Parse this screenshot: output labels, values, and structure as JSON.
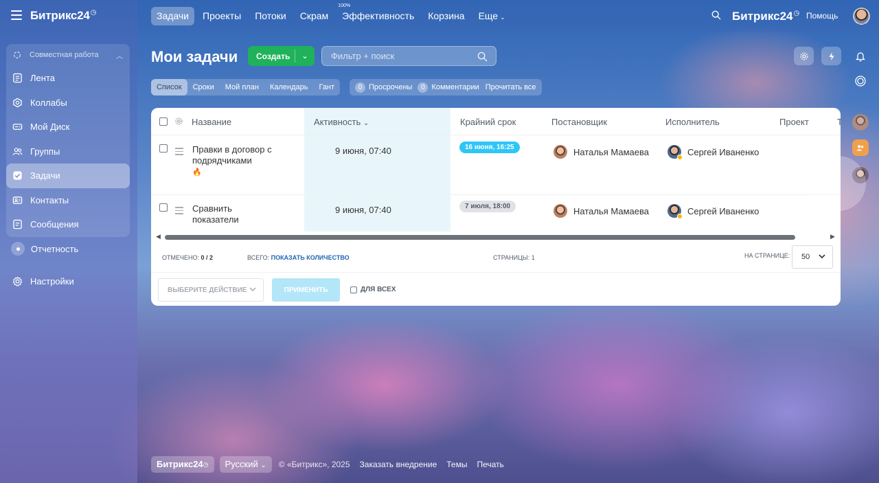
{
  "header": {
    "logo": "Битрикс24",
    "logo_mark": "◷",
    "nav": [
      {
        "label": "Задачи",
        "active": true
      },
      {
        "label": "Проекты"
      },
      {
        "label": "Потоки"
      },
      {
        "label": "Скрам"
      },
      {
        "label": "Эффективность",
        "sup": "100%"
      },
      {
        "label": "Корзина"
      },
      {
        "label": "Еще",
        "chevron": "⌄"
      }
    ],
    "brand_right": "Битрикс24",
    "help": "Помощь"
  },
  "sidebar": {
    "group_title": "Совместная работа",
    "items": [
      {
        "label": "Лента",
        "icon": "feed-icon"
      },
      {
        "label": "Коллабы",
        "icon": "collab-icon"
      },
      {
        "label": "Мой Диск",
        "icon": "disk-icon"
      },
      {
        "label": "Группы",
        "icon": "groups-icon"
      },
      {
        "label": "Задачи",
        "icon": "tasks-icon",
        "active": true
      },
      {
        "label": "Контакты",
        "icon": "contacts-icon"
      },
      {
        "label": "Сообщения",
        "icon": "messages-icon"
      }
    ],
    "reports": "Отчетность",
    "settings": "Настройки"
  },
  "page": {
    "title": "Мои задачи",
    "create": "Создать",
    "filter_placeholder": "Фильтр + поиск"
  },
  "views": {
    "tabs": [
      "Список",
      "Сроки",
      "Мой план",
      "Календарь",
      "Гант"
    ],
    "overdue_count": "0",
    "overdue_label": "Просрочены",
    "comments_count": "0",
    "comments_label": "Комментарии",
    "read_all": "Прочитать все"
  },
  "grid": {
    "columns": {
      "name": "Название",
      "activity": "Активность",
      "deadline": "Крайний срок",
      "creator": "Постановщик",
      "responsible": "Исполнитель",
      "project": "Проект",
      "cut": "Т"
    },
    "rows": [
      {
        "name": "Правки в договор с подрядчиками",
        "activity": "9 июня, 07:40",
        "deadline": "16 июня, 16:25",
        "creator": "Наталья Мамаева",
        "responsible": "Сергей Иваненко",
        "hot": "🔥"
      },
      {
        "name": "Сравнить показатели",
        "activity": "9 июня, 07:40",
        "deadline": "7 июля, 18:00",
        "creator": "Наталья Мамаева",
        "responsible": "Сергей Иваненко"
      }
    ]
  },
  "footer_info": {
    "checked_label": "Отмечено:",
    "checked_value": "0 / 2",
    "total_label": "Всего:",
    "total_link": "Показать количество",
    "pages_label": "Страницы:",
    "pages_value": "1",
    "per_page_label": "На странице:",
    "per_page_value": "50"
  },
  "actions": {
    "select_placeholder": "Выберите действие",
    "apply": "Применить",
    "for_all": "Для всех"
  },
  "bottom": {
    "logo": "Битрикс24",
    "language": "Русский",
    "copyright": "© «Битрикс», 2025",
    "order": "Заказать внедрение",
    "themes": "Темы",
    "print": "Печать"
  },
  "colors": {
    "create_green": "#1fb25a",
    "deadline_blue": "#2fc6f6",
    "deadline_grey": "#e0e2e5",
    "activity_column": "#e8f6fb",
    "link_blue": "#2066b0"
  }
}
